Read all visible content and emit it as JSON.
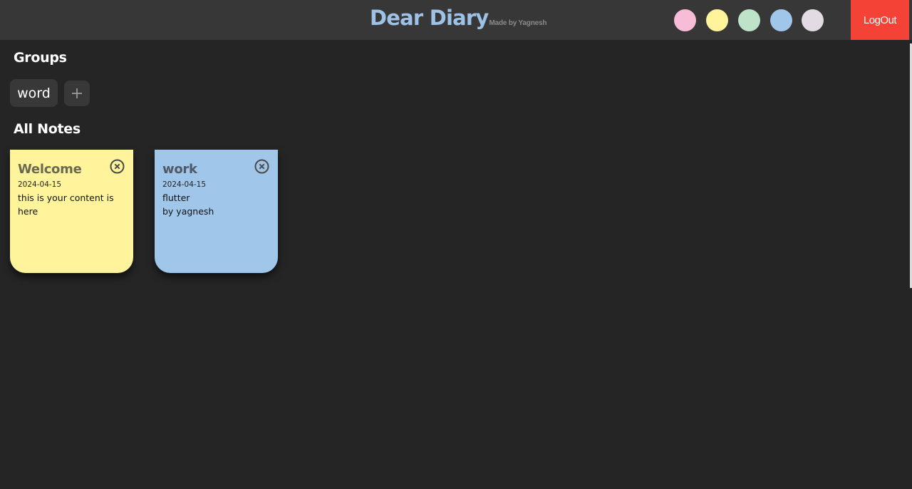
{
  "header": {
    "title": "Dear Diary",
    "subtitle": "Made by Yagnesh",
    "logout_label": "LogOut",
    "title_color": "#9ec1e6",
    "background": "#373737",
    "logout_color": "#f44336",
    "color_swatches": [
      {
        "name": "pink",
        "color": "#f7bcd7"
      },
      {
        "name": "yellow",
        "color": "#fff49b"
      },
      {
        "name": "green",
        "color": "#bfe3c9"
      },
      {
        "name": "blue",
        "color": "#a0c6ea"
      },
      {
        "name": "lavender",
        "color": "#e3dbe4"
      }
    ]
  },
  "groups": {
    "heading": "Groups",
    "items": [
      {
        "label": "word"
      }
    ],
    "add_icon": "plus-icon"
  },
  "notes": {
    "heading": "All Notes",
    "items": [
      {
        "title": "Welcome",
        "date": "2024-04-15",
        "content_lines": [
          "this is your content is",
          "here"
        ],
        "color": "#fff49b",
        "title_color": "#6a6a52",
        "close_icon": "close-circle-icon"
      },
      {
        "title": "work",
        "date": "2024-04-15",
        "content_lines": [
          "flutter",
          "by yagnesh"
        ],
        "color": "#a0c6ea",
        "title_color": "#4f5a66",
        "close_icon": "close-circle-icon"
      }
    ]
  },
  "colors": {
    "page_background": "#252525",
    "chip_background": "#383838"
  }
}
